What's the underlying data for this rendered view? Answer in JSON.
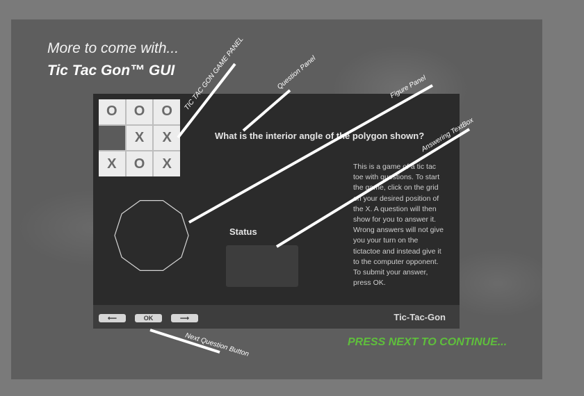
{
  "intro": {
    "line1": "More to come with...",
    "line2": "Tic Tac Gon™ GUI"
  },
  "game": {
    "grid": [
      {
        "value": "O",
        "state": "filled"
      },
      {
        "value": "O",
        "state": "filled"
      },
      {
        "value": "O",
        "state": "filled"
      },
      {
        "value": "",
        "state": "selected"
      },
      {
        "value": "X",
        "state": "filled"
      },
      {
        "value": "X",
        "state": "filled"
      },
      {
        "value": "X",
        "state": "filled"
      },
      {
        "value": "O",
        "state": "filled"
      },
      {
        "value": "X",
        "state": "filled"
      }
    ],
    "question": "What is the interior angle of the polygon shown?",
    "polygon_sides": 10,
    "status_label": "Status",
    "answer_value": "",
    "instructions": "This is a game of a tic tac toe with questions. To start the game, click on the grid on your desired position of the X. A question will then show for you to answer it. Wrong answers will not give you your turn on the tictactoe and instead give it to the computer opponent. To submit your answer, press OK.",
    "buttons": {
      "prev_label": "⟵",
      "ok_label": "OK",
      "next_label": "⟶"
    },
    "brand": "Tic-Tac-Gon"
  },
  "annotations": {
    "game_panel": "TIC TAC GON GAME PANEL",
    "question_panel": "Question Panel",
    "figure_panel": "Figure Panel",
    "answering_textbox": "Answering TextBox",
    "next_question_button": "Next Question Button"
  },
  "continue_text": "PRESS NEXT TO CONTINUE...",
  "colors": {
    "app_background": "#2b2b2b",
    "bottom_bar": "#3d3d3d",
    "continue_green": "#5fbf3c",
    "cell": "#ececec",
    "selected_cell": "#5b5b5b"
  }
}
